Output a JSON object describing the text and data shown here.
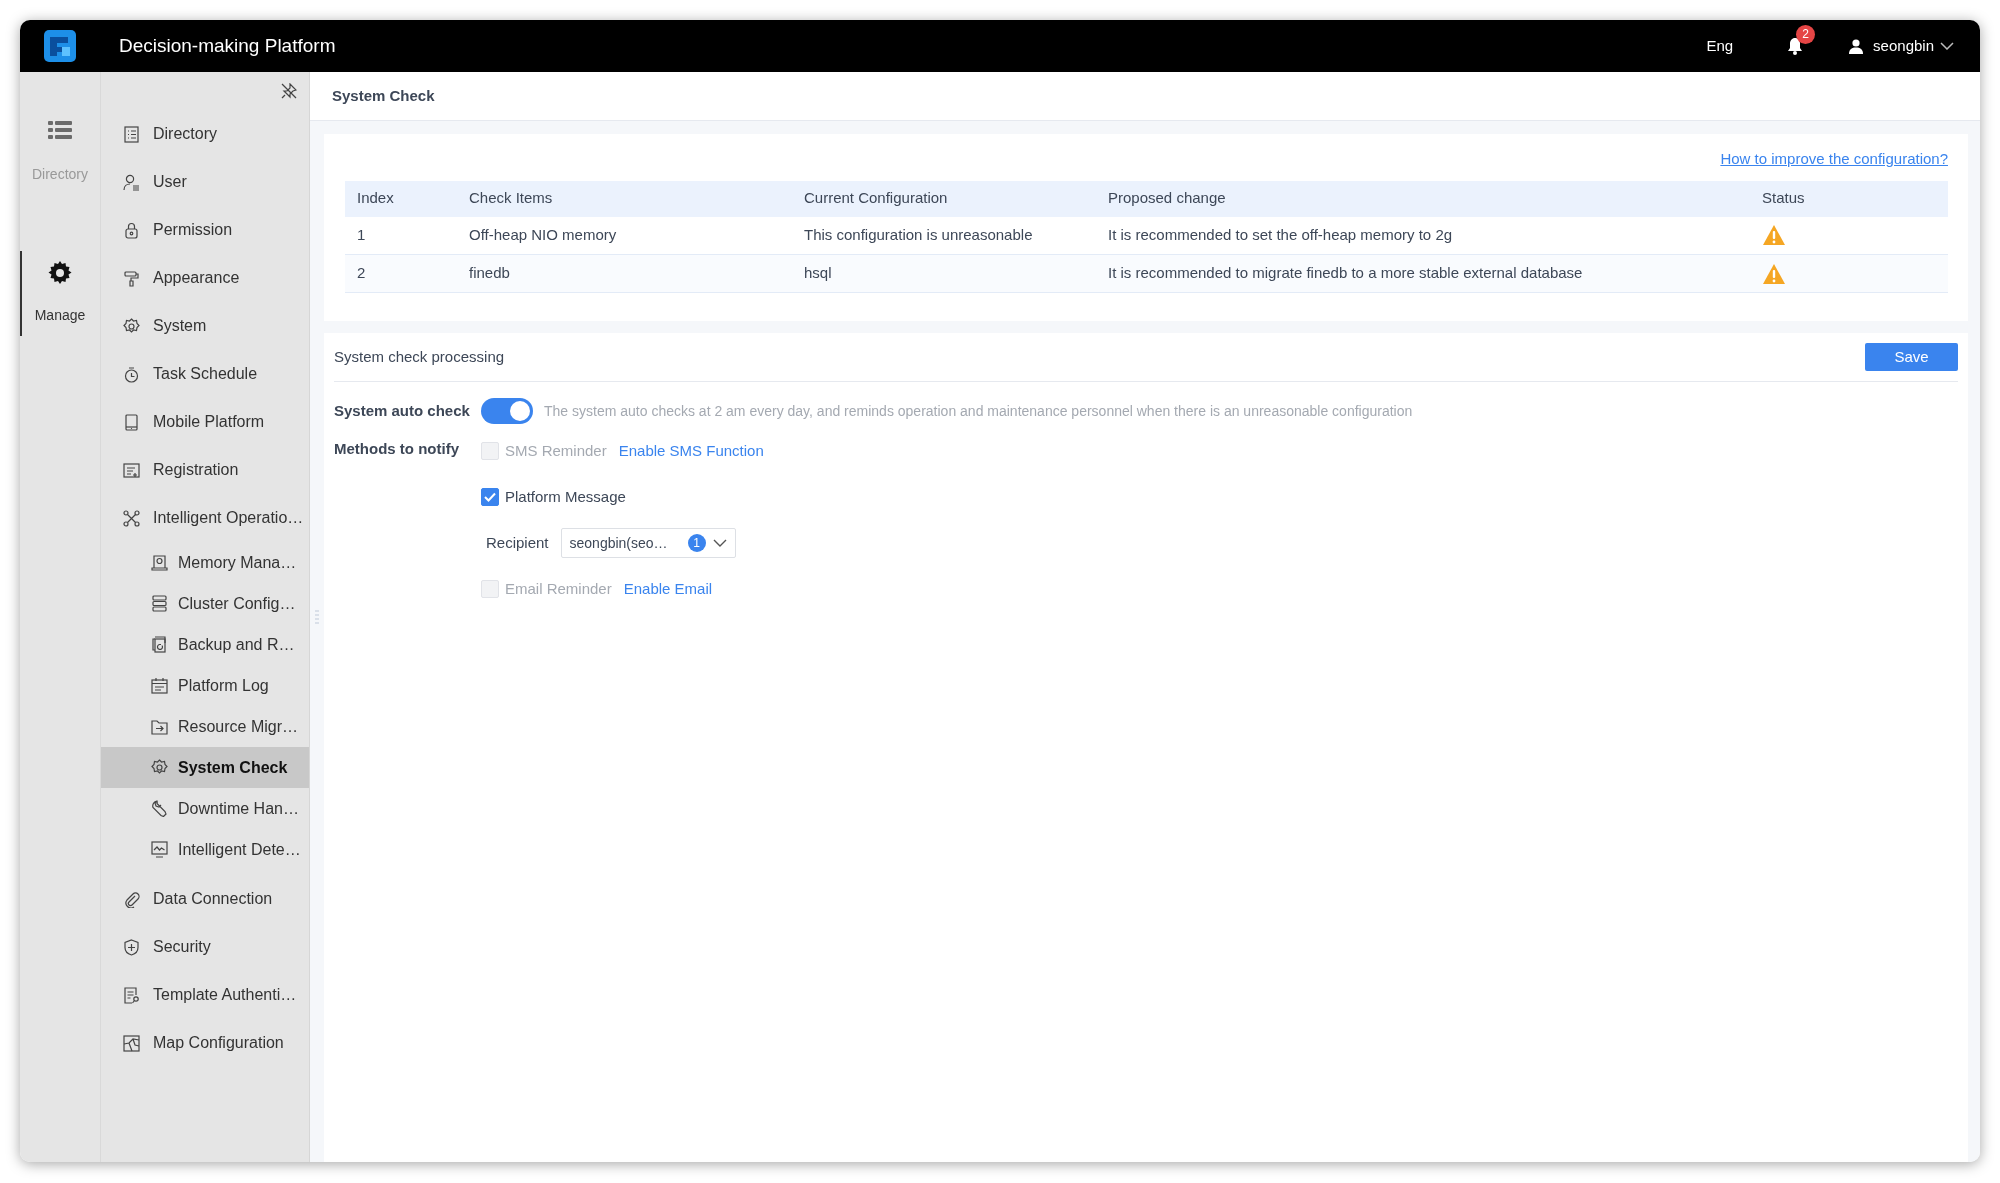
{
  "topbar": {
    "title": "Decision-making Platform",
    "language": "Eng",
    "notifications": "2",
    "user": "seongbin"
  },
  "rail": [
    {
      "label": "Directory",
      "selected": false
    },
    {
      "label": "Manage",
      "selected": true
    }
  ],
  "sidebar": {
    "items": [
      {
        "label": "Directory",
        "selected": false
      },
      {
        "label": "User",
        "selected": false
      },
      {
        "label": "Permission",
        "selected": false
      },
      {
        "label": "Appearance",
        "selected": false
      },
      {
        "label": "System",
        "selected": false
      },
      {
        "label": "Task Schedule",
        "selected": false
      },
      {
        "label": "Mobile Platform",
        "selected": false
      },
      {
        "label": "Registration",
        "selected": false
      },
      {
        "label": "Intelligent Operatio…",
        "selected": false,
        "children": [
          {
            "label": "Memory Mana…",
            "selected": false
          },
          {
            "label": "Cluster Config…",
            "selected": false
          },
          {
            "label": "Backup and R…",
            "selected": false
          },
          {
            "label": "Platform Log",
            "selected": false
          },
          {
            "label": "Resource Migr…",
            "selected": false
          },
          {
            "label": "System Check",
            "selected": true
          },
          {
            "label": "Downtime Han…",
            "selected": false
          },
          {
            "label": "Intelligent Dete…",
            "selected": false
          }
        ]
      },
      {
        "label": "Data Connection",
        "selected": false
      },
      {
        "label": "Security",
        "selected": false
      },
      {
        "label": "Template Authenti…",
        "selected": false
      },
      {
        "label": "Map Configuration",
        "selected": false
      }
    ]
  },
  "page": {
    "title": "System Check"
  },
  "check_table": {
    "help_link": "How to improve the configuration?",
    "columns": [
      "Index",
      "Check Items",
      "Current Configuration",
      "Proposed change",
      "Status"
    ],
    "rows": [
      {
        "index": "1",
        "item": "Off-heap NIO memory",
        "current": "This configuration is unreasonable",
        "proposal": "It is recommended to set the off-heap memory to 2g",
        "warning": true
      },
      {
        "index": "2",
        "item": "finedb",
        "current": "hsql",
        "proposal": "It is recommended to migrate finedb to a more stable external database",
        "warning": true
      }
    ]
  },
  "processing": {
    "title": "System check processing",
    "save": "Save",
    "auto_check": {
      "label": "System auto check",
      "on": true,
      "description": "The system auto checks at 2 am every day, and reminds operation and maintenance personnel when there is an unreasonable configuration"
    },
    "notify": {
      "label": "Methods to notify",
      "methods": [
        {
          "label": "SMS Reminder",
          "checked": false,
          "disabled": true,
          "link": "Enable SMS Function"
        },
        {
          "label": "Platform Message",
          "checked": true,
          "disabled": false,
          "recipient": {
            "label": "Recipient",
            "value": "seongbin(seo…",
            "count": "1"
          }
        },
        {
          "label": "Email Reminder",
          "checked": false,
          "disabled": true,
          "link": "Enable Email"
        }
      ]
    }
  }
}
